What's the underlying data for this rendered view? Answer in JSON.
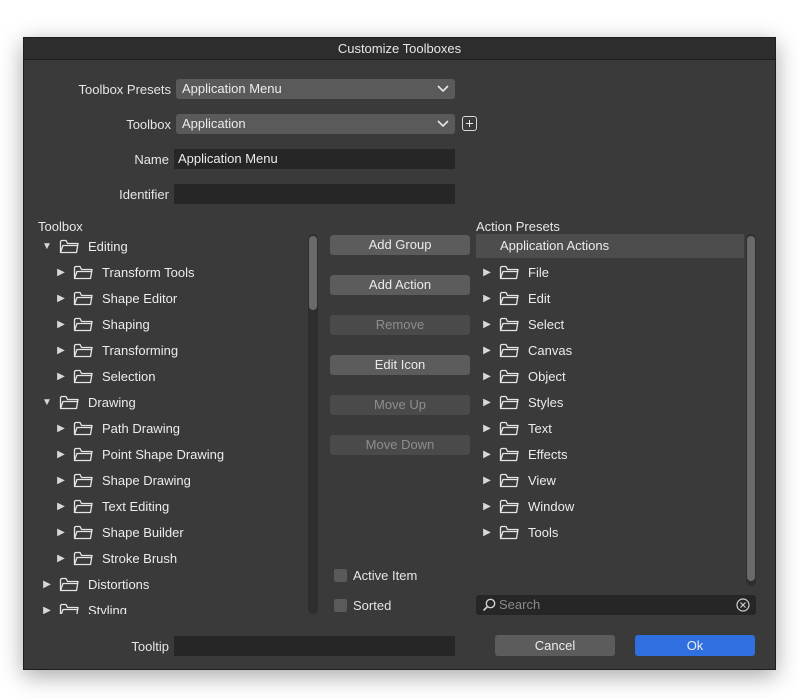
{
  "window": {
    "title": "Customize Toolboxes"
  },
  "form": {
    "presets_label": "Toolbox Presets",
    "presets_value": "Application Menu",
    "toolbox_label": "Toolbox",
    "toolbox_value": "Application",
    "name_label": "Name",
    "name_value": "Application Menu",
    "identifier_label": "Identifier",
    "identifier_value": ""
  },
  "toolbox_tree": {
    "title": "Toolbox",
    "items": [
      {
        "label": "Editing",
        "level": 0,
        "expanded": true
      },
      {
        "label": "Transform Tools",
        "level": 1,
        "expanded": false
      },
      {
        "label": "Shape Editor",
        "level": 1,
        "expanded": false
      },
      {
        "label": "Shaping",
        "level": 1,
        "expanded": false
      },
      {
        "label": "Transforming",
        "level": 1,
        "expanded": false
      },
      {
        "label": "Selection",
        "level": 1,
        "expanded": false
      },
      {
        "label": "Drawing",
        "level": 0,
        "expanded": true
      },
      {
        "label": "Path Drawing",
        "level": 1,
        "expanded": false
      },
      {
        "label": "Point Shape Drawing",
        "level": 1,
        "expanded": false
      },
      {
        "label": "Shape Drawing",
        "level": 1,
        "expanded": false
      },
      {
        "label": "Text Editing",
        "level": 1,
        "expanded": false
      },
      {
        "label": "Shape Builder",
        "level": 1,
        "expanded": false
      },
      {
        "label": "Stroke Brush",
        "level": 1,
        "expanded": false
      },
      {
        "label": "Distortions",
        "level": 0,
        "expanded": false
      },
      {
        "label": "Styling",
        "level": 0,
        "expanded": false
      }
    ]
  },
  "buttons": [
    {
      "label": "Add Group",
      "enabled": true
    },
    {
      "label": "Add Action",
      "enabled": true
    },
    {
      "label": "Remove",
      "enabled": false
    },
    {
      "label": "Edit Icon",
      "enabled": true
    },
    {
      "label": "Move Up",
      "enabled": false
    },
    {
      "label": "Move Down",
      "enabled": false
    }
  ],
  "checkboxes": {
    "active_item": "Active Item",
    "sorted": "Sorted"
  },
  "action_presets": {
    "title": "Action Presets",
    "header": "Application Actions",
    "items": [
      "File",
      "Edit",
      "Select",
      "Canvas",
      "Object",
      "Styles",
      "Text",
      "Effects",
      "View",
      "Window",
      "Tools"
    ]
  },
  "search": {
    "placeholder": "Search"
  },
  "tooltip": {
    "label": "Tooltip",
    "value": ""
  },
  "footer": {
    "cancel_label": "Cancel",
    "ok_label": "Ok"
  },
  "colors": {
    "accent": "#2f6fe0",
    "dialog_bg": "#3a3a3a",
    "field_bg": "#262626"
  }
}
